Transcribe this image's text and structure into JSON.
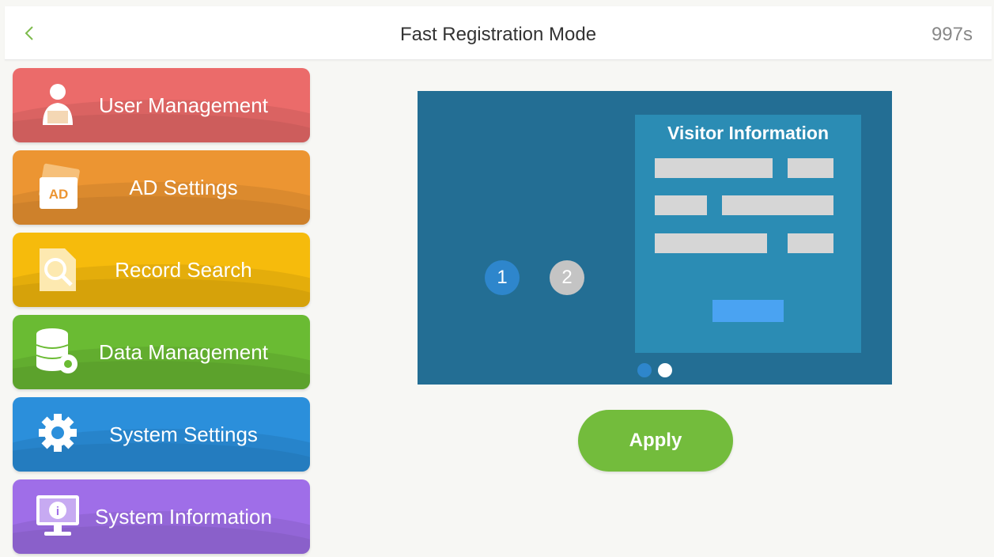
{
  "header": {
    "title": "Fast Registration Mode",
    "countdown": "997s",
    "back_icon": "chevron-left-icon"
  },
  "menu": {
    "items": [
      {
        "label": "User Management",
        "icon": "user-icon",
        "color": "#eb6b6a"
      },
      {
        "label": "AD Settings",
        "icon": "ad-icon",
        "icon_text": "AD",
        "color": "#ec9532"
      },
      {
        "label": "Record Search",
        "icon": "magnifier-icon",
        "color": "#f6bb0c"
      },
      {
        "label": "Data Management",
        "icon": "database-gear-icon",
        "color": "#6abb33"
      },
      {
        "label": "System Settings",
        "icon": "gear-icon",
        "color": "#2b8fdb"
      },
      {
        "label": "System Information",
        "icon": "monitor-info-icon",
        "icon_text": "i",
        "color": "#9f6ee8"
      }
    ]
  },
  "preview": {
    "steps": [
      "1",
      "2"
    ],
    "panel_title": "Visitor Information",
    "page_indicator": {
      "total": 2,
      "active": 2
    }
  },
  "actions": {
    "apply_label": "Apply",
    "apply_color": "#73bc3c"
  }
}
